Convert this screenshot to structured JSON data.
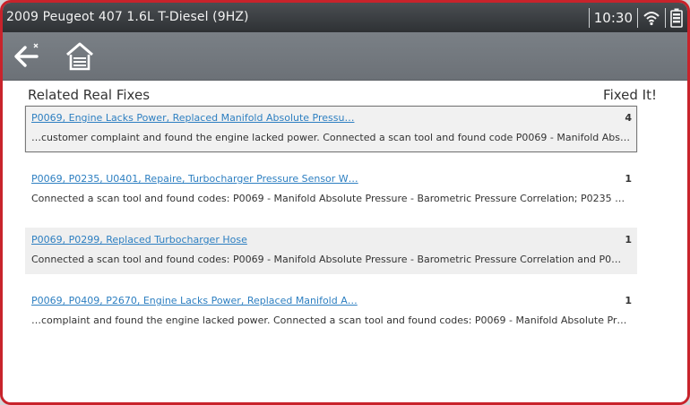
{
  "titlebar": {
    "vehicle": "2009 Peugeot 407 1.6L T-Diesel (9HZ)",
    "time": "10:30",
    "wifi_icon": "wifi-icon",
    "battery_icon": "battery-icon"
  },
  "toolbar": {
    "back_icon": "back-arrow-icon",
    "home_icon": "home-icon"
  },
  "list": {
    "header_left": "Related Real Fixes",
    "header_right": "Fixed It!",
    "items": [
      {
        "title": "P0069, Engine Lacks Power, Replaced Manifold Absolute Pressu…",
        "count": "4",
        "desc": "…customer complaint and found the engine lacked power. Connected a scan tool and found code P0069 - Manifold Abs…"
      },
      {
        "title": "P0069, P0235, U0401, Repaire, Turbocharger Pressure Sensor W…",
        "count": "1",
        "desc": "Connected a scan tool and found codes: P0069 - Manifold Absolute Pressure - Barometric Pressure Correlation; P0235 …"
      },
      {
        "title": "P0069, P0299, Replaced Turbocharger Hose",
        "count": "1",
        "desc": "Connected a scan tool and found codes: P0069 - Manifold Absolute Pressure - Barometric Pressure Correlation and P0…"
      },
      {
        "title": "P0069, P0409, P2670, Engine Lacks Power, Replaced Manifold A…",
        "count": "1",
        "desc": "…complaint and found the engine lacked power. Connected a scan tool and found codes: P0069 - Manifold Absolute Pr…"
      }
    ]
  },
  "colors": {
    "frame": "#c8232b",
    "titlebar": "#2e3134",
    "toolbar": "#6c7177",
    "link": "#2d7fc1"
  }
}
